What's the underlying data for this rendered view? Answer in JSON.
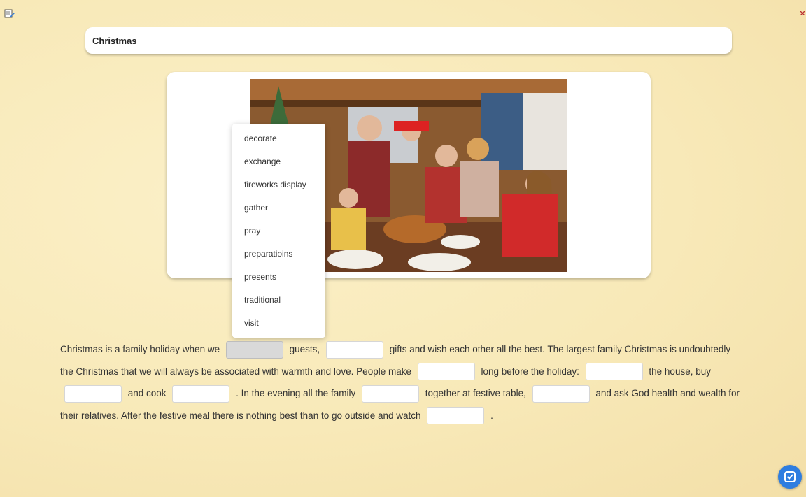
{
  "title": "Christmas",
  "dropdown": {
    "options": [
      "decorate",
      "exchange",
      "fireworks display",
      "gather",
      "pray",
      "preparatioins",
      "presents",
      "traditional",
      "visit"
    ]
  },
  "passage": {
    "lines": [
      [
        "Christmas is a family holiday when we",
        "guests,",
        "gifts and wish each other all the best. The largest family Christmas is undoubtedly"
      ],
      [
        "the Christmas that we will always be associated with warmth and love. People make",
        "long before the holiday:",
        "the house, buy"
      ],
      [
        "and cook",
        ". In the evening all the family",
        "together at festive table,",
        "and ask God health and wealth for"
      ],
      [
        "their relatives. After the festive meal there is nothing best than to go outside and watch",
        "."
      ]
    ]
  },
  "icons": {
    "corner": "edit-help-icon",
    "check": "check-square-icon"
  },
  "colors": {
    "accent": "#2e7de0",
    "background": "#f8e9b8",
    "blank_active": "#d9d9d9"
  }
}
